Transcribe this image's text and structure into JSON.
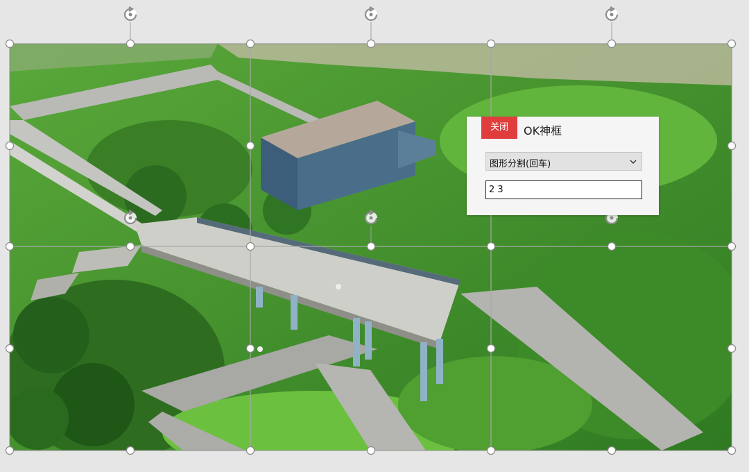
{
  "panel": {
    "close_label": "关闭",
    "title": "OK神框",
    "split_mode": {
      "selected": "图形分割(回车)"
    },
    "grid_value": "2 3"
  },
  "colors": {
    "close_button": "#e03d3d",
    "panel_bg": "#f5f5f5",
    "selection_handle": "#ffffff",
    "selection_outline": "#8a8a8a"
  },
  "icons": {
    "rotate": "rotate-icon",
    "dropdown": "chevron-down-icon"
  }
}
